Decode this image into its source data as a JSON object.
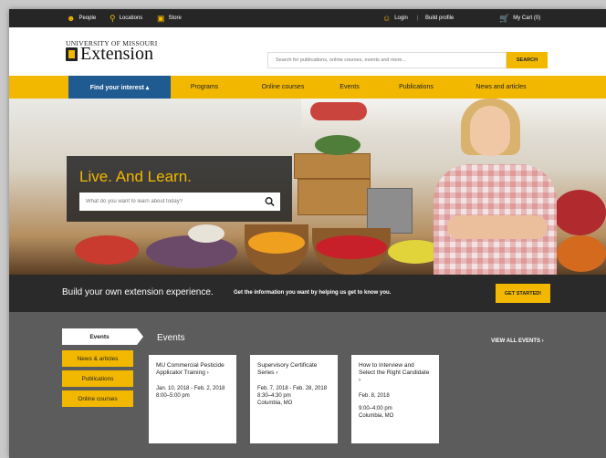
{
  "utility": {
    "people": "People",
    "locations": "Locations",
    "store": "Store",
    "login": "Login",
    "separator": "|",
    "build_profile": "Build profile",
    "cart": "My Cart (0)"
  },
  "header": {
    "logo_top": "UNIVERSITY OF MISSOURI",
    "logo_word": "Extension",
    "search_placeholder": "Search for publications, online courses, events and more...",
    "search_button": "SEARCH"
  },
  "nav": {
    "interest": "Find your interest ▴",
    "items": [
      "Programs",
      "Online courses",
      "Events",
      "Publications",
      "News and articles"
    ]
  },
  "hero": {
    "title": "Live. And Learn.",
    "search_placeholder": "What do you want to learn about today?"
  },
  "build": {
    "heading": "Build your own extension experience.",
    "subtext": "Get the information you want by helping us get to know you.",
    "button": "GET STARTED!"
  },
  "events": {
    "side_tabs": [
      "Events",
      "News & articles",
      "Publications",
      "Online courses"
    ],
    "title": "Events",
    "view_all": "VIEW ALL EVENTS ›",
    "cards": [
      {
        "title": "MU Commercial Pesticide Applicator Training ›",
        "dates": "Jan. 10, 2018 - Feb. 2, 2018",
        "time": "8:00–5:00 pm",
        "location": ""
      },
      {
        "title": "Supervisory Certificate Series ›",
        "dates": "Feb. 7, 2018 - Feb. 28, 2018",
        "time": "8:30–4:30 pm",
        "location": "Columbia, MO"
      },
      {
        "title": "How to Interview and Select the Right Candidate ›",
        "dates": "Feb. 8, 2018",
        "time": "9:00–4:00 pm",
        "location": "Columbia, MO"
      }
    ]
  },
  "colors": {
    "accent_gold": "#f2b800",
    "nav_blue": "#1f5a91",
    "dark_bar": "#262626",
    "events_bg": "#5c5c5c"
  },
  "icons": [
    "people-icon",
    "location-pin-icon",
    "store-icon",
    "user-icon",
    "cart-icon",
    "search-icon",
    "chevron-up-icon"
  ]
}
